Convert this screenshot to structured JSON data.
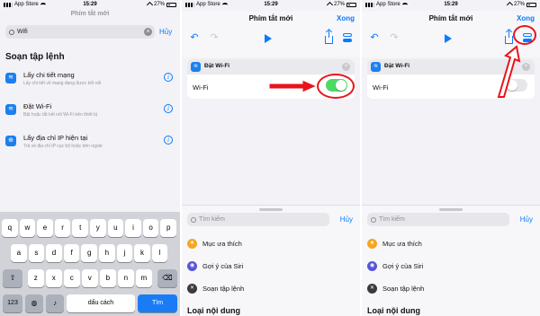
{
  "status": {
    "carrier": "App Store",
    "time": "15:29",
    "battery": "27%"
  },
  "panel1": {
    "ghost_title": "Phím tắt mới",
    "search_value": "Wifi",
    "cancel": "Hủy",
    "section_title": "Soạn tập lệnh",
    "actions": [
      {
        "title": "Lấy chi tiết mạng",
        "subtitle": "Lấy chi tiết về mạng đang được kết nối",
        "icon": "wifi-icon"
      },
      {
        "title": "Đặt Wi-Fi",
        "subtitle": "Bật hoặc tắt kết nối Wi-Fi trên thiết bị",
        "icon": "wifi-icon"
      },
      {
        "title": "Lấy địa chỉ IP hiện tại",
        "subtitle": "Trả về địa chỉ IP cục bộ hoặc bên ngoài",
        "icon": "globe-icon"
      }
    ],
    "keyboard": {
      "row1": [
        "q",
        "w",
        "e",
        "r",
        "t",
        "y",
        "u",
        "i",
        "o",
        "p"
      ],
      "row2": [
        "a",
        "s",
        "d",
        "f",
        "g",
        "h",
        "j",
        "k",
        "l"
      ],
      "row3": [
        "z",
        "x",
        "c",
        "v",
        "b",
        "n",
        "m"
      ],
      "num": "123",
      "space": "dấu cách",
      "action": "Tìm"
    }
  },
  "editor": {
    "title": "Phím tắt mới",
    "done": "Xong",
    "action_name": "Đặt Wi-Fi",
    "param_label": "Wi-Fi",
    "toggle_panel2": 1,
    "toggle_panel3": 0
  },
  "library": {
    "search_placeholder": "Tìm kiếm",
    "cancel": "Hủy",
    "items": [
      {
        "label": "Mục ưa thích",
        "icon": "star-icon",
        "color": "#f5a623"
      },
      {
        "label": "Gợi ý của Siri",
        "icon": "siri-icon",
        "color": "#5856d6"
      },
      {
        "label": "Soạn tập lệnh",
        "icon": "script-icon",
        "color": "#3a3a3c"
      }
    ],
    "section": "Loại nội dung"
  },
  "colors": {
    "accent": "#0a7aff",
    "toggle_on": "#4cd964",
    "annotation": "#e8141b"
  }
}
